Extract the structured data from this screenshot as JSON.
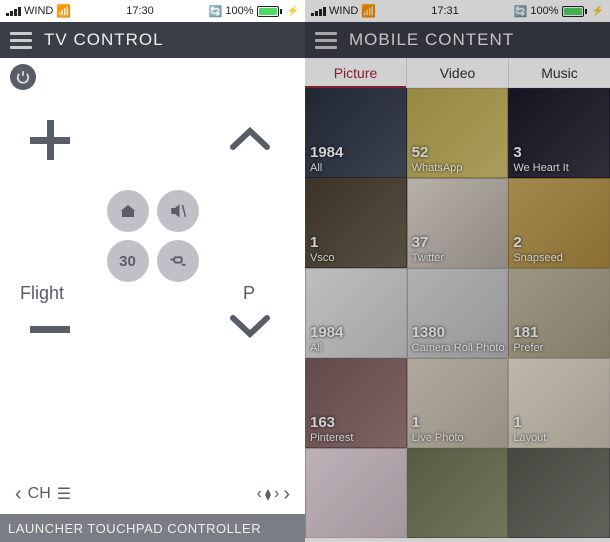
{
  "left": {
    "status": {
      "carrier": "WIND",
      "time": "17:30",
      "battery": "100%"
    },
    "header": {
      "title": "TV CONTROL"
    },
    "labels": {
      "flight": "Flight",
      "p": "P",
      "thirty": "30",
      "ch": "CH"
    },
    "footer": "LAUNCHER TOUCHPAD CONTROLLER"
  },
  "right": {
    "status": {
      "carrier": "WIND",
      "time": "17:31",
      "battery": "100%"
    },
    "header": {
      "title": "MOBILE CONTENT"
    },
    "tabs": {
      "picture": "Picture",
      "video": "Video",
      "music": "Music"
    },
    "albums": [
      {
        "count": "1984",
        "name": "All"
      },
      {
        "count": "52",
        "name": "WhatsApp"
      },
      {
        "count": "3",
        "name": "We Heart It"
      },
      {
        "count": "1",
        "name": "Vsco"
      },
      {
        "count": "37",
        "name": "Twitter"
      },
      {
        "count": "2",
        "name": "Snapseed"
      },
      {
        "count": "1984",
        "name": "All"
      },
      {
        "count": "1380",
        "name": "Camera Roll Photo"
      },
      {
        "count": "181",
        "name": "Prefer"
      },
      {
        "count": "163",
        "name": "Pinterest"
      },
      {
        "count": "1",
        "name": "Live Photo"
      },
      {
        "count": "1",
        "name": "Layout"
      },
      {
        "count": "",
        "name": ""
      },
      {
        "count": "",
        "name": ""
      },
      {
        "count": "",
        "name": ""
      }
    ]
  }
}
